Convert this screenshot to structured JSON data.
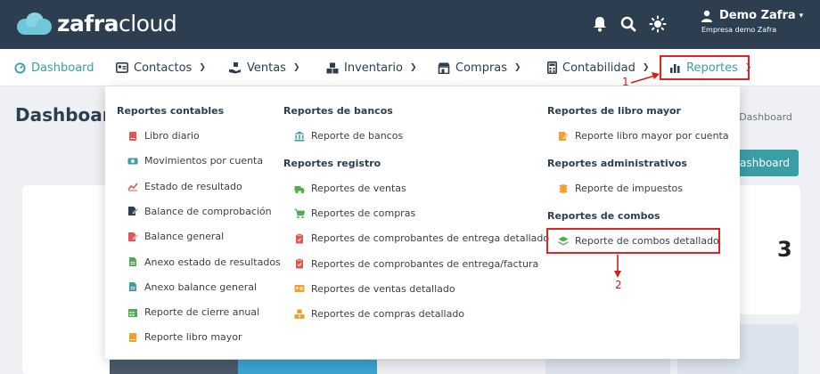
{
  "brand": {
    "part1": "zafra",
    "part2": "cloud"
  },
  "user": {
    "name": "Demo Zafra",
    "company": "Empresa demo Zafra"
  },
  "nav": [
    {
      "label": "Dashboard"
    },
    {
      "label": "Contactos"
    },
    {
      "label": "Ventas"
    },
    {
      "label": "Inventario"
    },
    {
      "label": "Compras"
    },
    {
      "label": "Contabilidad"
    },
    {
      "label": "Reportes"
    }
  ],
  "page": {
    "title": "Dashboard",
    "breadcrumb": "/  Dashboard",
    "button": "dashboard",
    "card_value": "3"
  },
  "dropdown": {
    "col1": {
      "heading": "Reportes contables",
      "items": [
        {
          "label": "Libro diario",
          "icon": "book-icon",
          "color": "#e25555"
        },
        {
          "label": "Movimientos por cuenta",
          "icon": "money-icon",
          "color": "#3a9ea5"
        },
        {
          "label": "Estado de resultado",
          "icon": "line-chart-icon",
          "color": "#e25555"
        },
        {
          "label": "Balance de comprobación",
          "icon": "edit-file-icon",
          "color": "#2c3e50"
        },
        {
          "label": "Balance general",
          "icon": "edit-file-icon",
          "color": "#e25555"
        },
        {
          "label": "Anexo estado de resultados",
          "icon": "file-icon",
          "color": "#4caf50"
        },
        {
          "label": "Anexo balance general",
          "icon": "file-icon",
          "color": "#3a9ea5"
        },
        {
          "label": "Reporte de cierre anual",
          "icon": "calendar-icon",
          "color": "#4caf50"
        },
        {
          "label": "Reporte libro mayor",
          "icon": "book-icon",
          "color": "#f0a030"
        }
      ]
    },
    "col2": {
      "heading_a": "Reportes de bancos",
      "items_a": [
        {
          "label": "Reporte de bancos",
          "icon": "bank-icon",
          "color": "#3a9ea5"
        }
      ],
      "heading_b": "Reportes registro",
      "items_b": [
        {
          "label": "Reportes de ventas",
          "icon": "truck-icon",
          "color": "#4caf50"
        },
        {
          "label": "Reportes de compras",
          "icon": "cart-icon",
          "color": "#4caf50"
        },
        {
          "label": "Reportes de comprobantes de entrega detallado",
          "icon": "clipboard-icon",
          "color": "#e25555"
        },
        {
          "label": "Reportes de comprobantes de entrega/factura",
          "icon": "clipboard-icon",
          "color": "#e25555"
        },
        {
          "label": "Reportes de ventas detallado",
          "icon": "id-card-icon",
          "color": "#f0a030"
        },
        {
          "label": "Reportes de compras detallado",
          "icon": "boxes-icon",
          "color": "#f0a030"
        }
      ]
    },
    "col3": {
      "heading_a": "Reportes de libro mayor",
      "items_a": [
        {
          "label": "Reporte libro mayor por cuenta",
          "icon": "edit-file-icon",
          "color": "#f0a030"
        }
      ],
      "heading_b": "Reportes administrativos",
      "items_b": [
        {
          "label": "Reporte de impuestos",
          "icon": "coins-icon",
          "color": "#f0a030"
        }
      ],
      "heading_c": "Reportes de combos",
      "items_c": [
        {
          "label": "Reporte de combos detallado",
          "icon": "layers-icon",
          "color": "#4caf50"
        }
      ]
    }
  },
  "annotations": {
    "one": "1",
    "two": "2"
  },
  "colors": {
    "topbar": "#2c3e50",
    "accent": "#3a9ea5",
    "highlight": "#e02424"
  }
}
